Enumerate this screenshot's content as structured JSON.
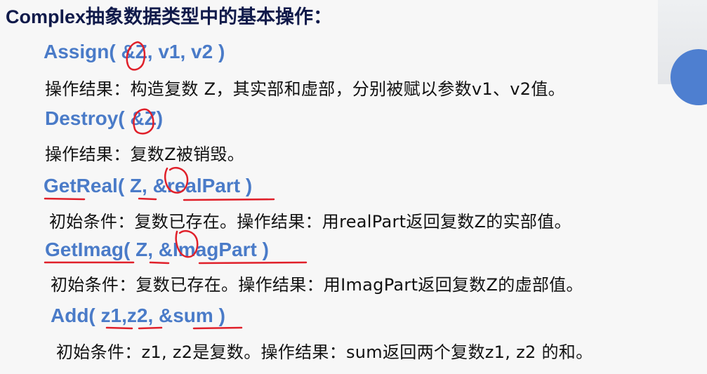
{
  "title": "Complex抽象数据类型中的基本操作：",
  "operations": [
    {
      "signature": "Assign( &Z, v1, v2 )",
      "description": "操作结果：构造复数 Z，其实部和虚部，分别被赋以参数v1、v2值。"
    },
    {
      "signature": "Destroy( &Z)",
      "description": "操作结果：复数Z被销毁。"
    },
    {
      "signature": "GetReal( Z, &realPart )",
      "description": "初始条件：复数已存在。操作结果：用realPart返回复数Z的实部值。"
    },
    {
      "signature": "GetImag( Z, &ImagPart )",
      "description": "初始条件：复数已存在。操作结果：用ImagPart返回复数Z的虚部值。"
    },
    {
      "signature": "Add( z1,z2, &sum )",
      "description": "初始条件：z1, z2是复数。操作结果：sum返回两个复数z1, z2 的和。"
    }
  ],
  "colors": {
    "title": "#101a4a",
    "operation": "#4a7bc8",
    "annotation": "#e0202a",
    "background": "#f7f7f7"
  }
}
